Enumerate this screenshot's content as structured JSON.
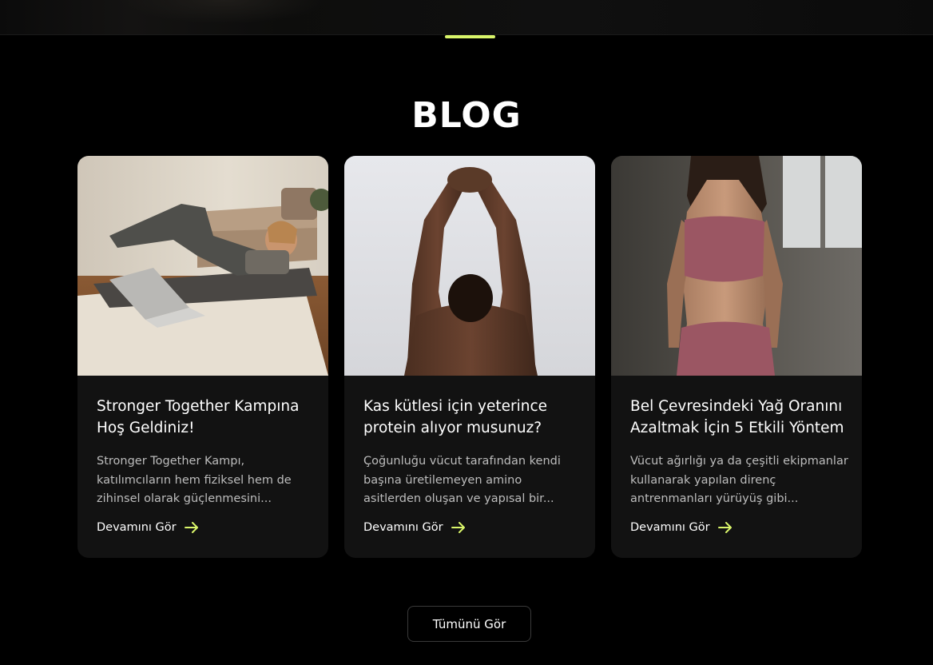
{
  "section": {
    "title": "BLOG",
    "accent_color": "#d9f56a"
  },
  "posts": [
    {
      "title": "Stronger Together Kampına Hoş Geldiniz!",
      "excerpt": "Stronger Together Kampı, katılımcıların hem fiziksel hem de zihinsel olarak güçlenmesini...",
      "link_label": "Devamını Gör",
      "link_icon": "arrow-right-icon",
      "image": "woman-exercising-on-mat-with-laptop"
    },
    {
      "title": "Kas kütlesi için yeterince protein alıyor musunuz?",
      "excerpt": "Çoğunluğu vücut tarafından kendi başına üretilemeyen amino asitlerden oluşan ve yapısal bir...",
      "link_label": "Devamını Gör",
      "link_icon": "arrow-right-icon",
      "image": "man-stretching-arms-overhead"
    },
    {
      "title": "Bel Çevresindeki Yağ Oranını Azaltmak İçin 5 Etkili Yöntem",
      "excerpt": "Vücut ağırlığı ya da çeşitli ekipmanlar kullanarak yapılan direnç antrenmanları yürüyüş gibi...",
      "link_label": "Devamını Gör",
      "link_icon": "arrow-right-icon",
      "image": "woman-in-pink-sportswear"
    }
  ],
  "view_all_label": "Tümünü Gör"
}
